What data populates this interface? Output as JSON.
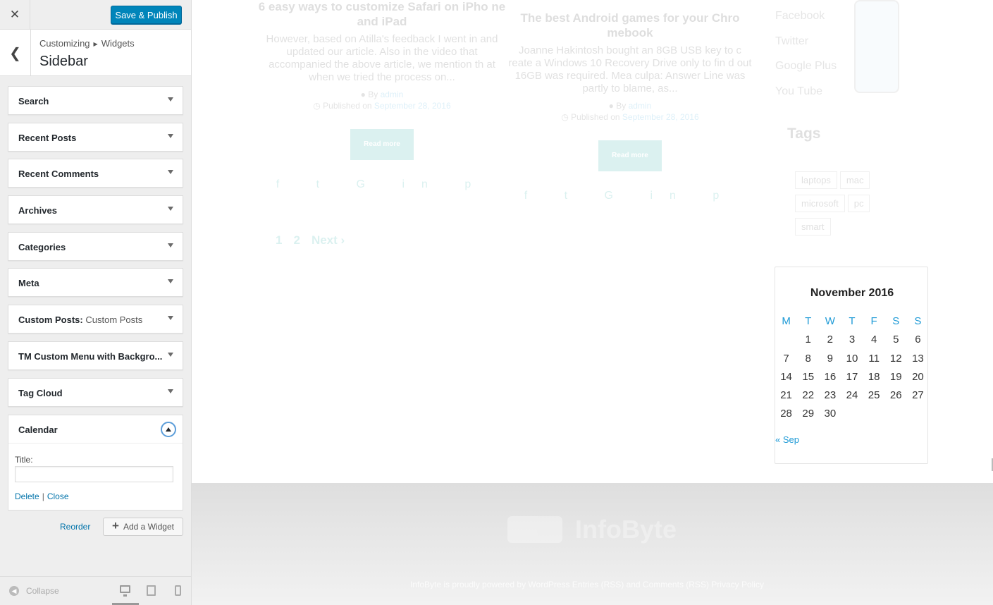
{
  "customizer": {
    "close_icon": "✕",
    "save_label": "Save & Publish",
    "breadcrumb": {
      "root": "Customizing",
      "parent": "Widgets"
    },
    "section_title": "Sidebar",
    "widgets": [
      {
        "title": "Search",
        "sub": ""
      },
      {
        "title": "Recent Posts",
        "sub": ""
      },
      {
        "title": "Recent Comments",
        "sub": ""
      },
      {
        "title": "Archives",
        "sub": ""
      },
      {
        "title": "Categories",
        "sub": ""
      },
      {
        "title": "Meta",
        "sub": ""
      },
      {
        "title": "Custom Posts:",
        "sub": "Custom Posts"
      },
      {
        "title": "TM Custom Menu with Backgro...",
        "sub": ""
      },
      {
        "title": "Tag Cloud",
        "sub": ""
      }
    ],
    "expanded_widget": {
      "title": "Calendar",
      "field_label": "Title:",
      "field_value": "",
      "delete_label": "Delete",
      "separator": "|",
      "close_label": "Close"
    },
    "reorder_label": "Reorder",
    "add_widget_label": "Add a Widget",
    "collapse_label": "Collapse",
    "accent_color": "#0085ba",
    "link_color": "#0073aa"
  },
  "preview": {
    "posts": [
      {
        "title": "6 easy ways to customize Safari on iPho ne and iPad",
        "excerpt": "However, based on Atilla's feedback I went in and updated our article. Also in the video that accompanied the above article, we mention th at when we tried the process on...",
        "by_label": "By",
        "author": "admin",
        "published_label": "Published on",
        "date": "September 28, 2016",
        "button": "Read more"
      },
      {
        "title": "The best Android games for your Chro mebook",
        "excerpt": "Joanne Hakintosh bought an 8GB USB key to c reate a Windows 10 Recovery Drive only to fin d out 16GB was required. Mea culpa: Answer Line was partly to blame, as...",
        "by_label": "By",
        "author": "admin",
        "published_label": "Published on",
        "date": "September 28, 2016",
        "button": "Read more"
      }
    ],
    "pagination": {
      "page1": "1",
      "page2": "2",
      "next": "Next ›"
    },
    "social_links": [
      "Facebook",
      "Twitter",
      "Google Plus",
      "You Tube"
    ],
    "tags_title": "Tags",
    "tags": [
      "laptops",
      "mac",
      "microsoft",
      "pc",
      "smart"
    ],
    "calendar": {
      "month": "November 2016",
      "weekdays": [
        "M",
        "T",
        "W",
        "T",
        "F",
        "S",
        "S"
      ],
      "weeks": [
        [
          "",
          "1",
          "2",
          "3",
          "4",
          "5",
          "6"
        ],
        [
          "7",
          "8",
          "9",
          "10",
          "11",
          "12",
          "13"
        ],
        [
          "14",
          "15",
          "16",
          "17",
          "18",
          "19",
          "20"
        ],
        [
          "21",
          "22",
          "23",
          "24",
          "25",
          "26",
          "27"
        ],
        [
          "28",
          "29",
          "30",
          "",
          "",
          "",
          ""
        ]
      ],
      "prev_link": "« Sep"
    },
    "footer": {
      "logo_text": "InfoByte",
      "credits": "InfoByte is proudly powered by WordPress Entries (RSS) and Comments (RSS) Privacy Policy"
    },
    "accent_color": "#0fa39c"
  }
}
